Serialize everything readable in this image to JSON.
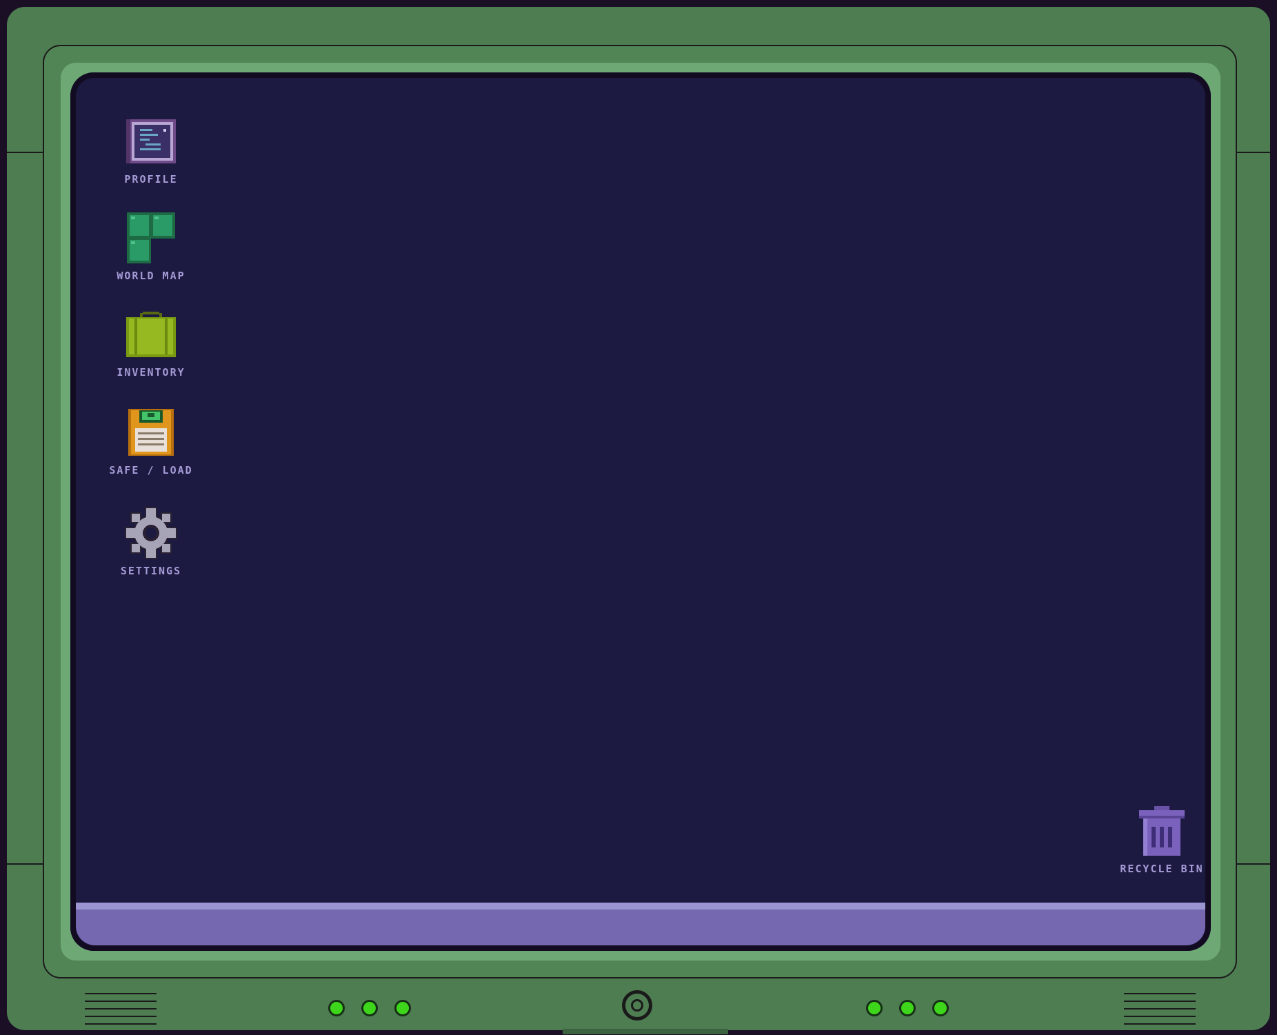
{
  "desktop": {
    "icons": [
      {
        "label": "PROFILE",
        "icon": "profile-document-icon"
      },
      {
        "label": "WORLD MAP",
        "icon": "world-map-icon"
      },
      {
        "label": "INVENTORY",
        "icon": "briefcase-icon"
      },
      {
        "label": "SAFE / LOAD",
        "icon": "floppy-disk-icon"
      },
      {
        "label": "SETTINGS",
        "icon": "gear-icon"
      }
    ],
    "recycle_bin": {
      "label": "RECYCLE BIN",
      "icon": "trash-can-icon"
    }
  },
  "colors": {
    "screen_bg": "#1c1a40",
    "taskbar": "#7568b0",
    "bezel": "#4e7d52",
    "bezel_light": "#6ea874",
    "led": "#3ed61a",
    "label": "#a49cd6"
  },
  "hardware": {
    "left_leds": [
      "led-on",
      "led-on",
      "led-on"
    ],
    "right_leds": [
      "led-on",
      "led-on",
      "led-on"
    ],
    "power_button": "power-button-icon"
  }
}
